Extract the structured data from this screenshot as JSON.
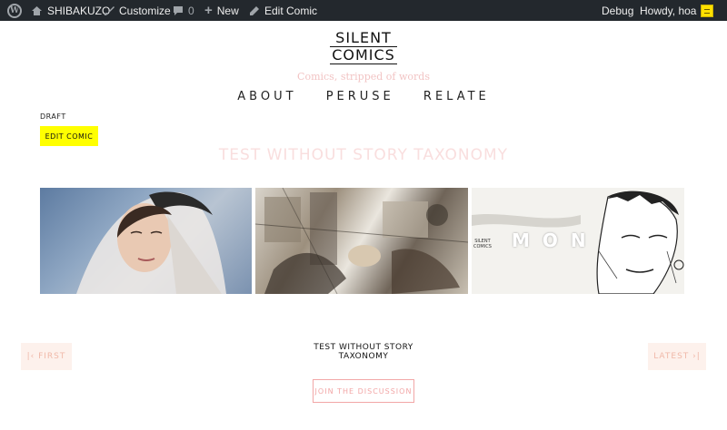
{
  "admin_bar": {
    "site_name": "SHIBAKUZO",
    "customize": "Customize",
    "comments_count": "0",
    "new": "New",
    "edit_comic": "Edit Comic",
    "debug": "Debug",
    "howdy": "Howdy, hoa",
    "icons": {
      "wp": "wordpress-icon",
      "site": "home-icon",
      "customize": "brush-icon",
      "comments": "comment-icon",
      "new": "plus-icon"
    }
  },
  "header": {
    "logo_line1": "SILENT",
    "logo_line2": "COMICS",
    "tagline": "Comics, stripped of words"
  },
  "nav": {
    "items": [
      "ABOUT",
      "PERUSE",
      "RELATE"
    ]
  },
  "post": {
    "status": "DRAFT",
    "edit_button": "EDIT COMIC",
    "title": "TEST WITHOUT STORY TAXONOMY"
  },
  "panels": {
    "panel3_text": "MON",
    "panel3_logo_line1": "SILENT",
    "panel3_logo_line2": "COMICS"
  },
  "footer": {
    "first_label": "|‹ FIRST",
    "latest_label": "LATEST ›|",
    "title_line1": "TEST WITHOUT STORY",
    "title_line2": "TAXONOMY",
    "join_label": "JOIN THE DISCUSSION"
  },
  "colors": {
    "admin_bg": "#23282d",
    "accent_yellow": "#ffff00",
    "pink": "#f2a6a6",
    "tagline_pink": "#f2c4c4"
  }
}
